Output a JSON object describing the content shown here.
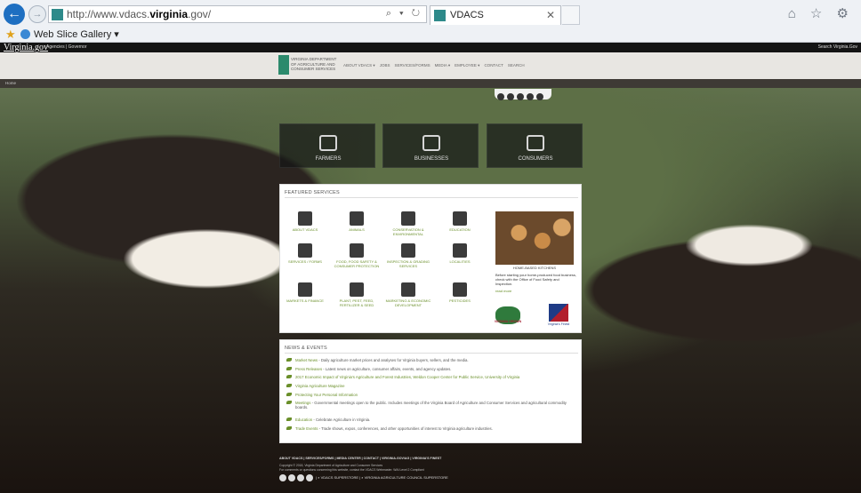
{
  "browser": {
    "url_prefix": "http://www.vdacs.",
    "url_host": "virginia",
    "url_suffix": ".gov/",
    "addr_tools": "⌕ ▾ ↻",
    "tab_title": "VDACS",
    "tab_close": "✕",
    "favorites_label": "Web Slice Gallery ▾",
    "back_glyph": "←",
    "fwd_glyph": "→",
    "chrome_icons": "⌂ ☆ ⚙"
  },
  "site": {
    "va_logo": "Virginia.gov",
    "va_links": "Agencies | Governor",
    "va_search": "Search Virginia.Gov",
    "org_name": "VIRGINIA DEPARTMENT OF AGRICULTURE AND CONSUMER SERVICES",
    "nav": [
      "ABOUT VDACS ▾",
      "JOBS",
      "SERVICES/FORMS",
      "MEDIA ▾",
      "EMPLOYEE ▾",
      "CONTACT",
      "SEARCH"
    ],
    "breadcrumb": "Home"
  },
  "tiles": [
    "FARMERS",
    "BUSINESSES",
    "CONSUMERS"
  ],
  "featured": {
    "heading": "FEATURED SERVICES",
    "services": [
      "ABOUT VDACS",
      "ANIMALS",
      "CONSERVATION & ENVIRONMENTAL",
      "EDUCATION",
      "SERVICES / FORMS",
      "FOOD, FOOD SAFETY & CONSUMER PROTECTION",
      "INSPECTION & GRADING SERVICES",
      "LOCALITIES",
      "MARKETS & FINANCE",
      "PLANT, PEST, FEED, FERTILIZER & SEED",
      "MARKETING & ECONOMIC DEVELOPMENT",
      "PESTICIDES"
    ],
    "promo_caption": "HOME-BASED KITCHENS",
    "promo_text": "Before starting your home-produced food business, check with the Office of Food Safety and Inspection.",
    "promo_more": "read more",
    "logo_grown": "VIRGINIA GROWN",
    "logo_finest": "Virginia's Finest"
  },
  "news": {
    "heading": "NEWS & EVENTS",
    "items": [
      {
        "title": "Market News",
        "text": " - Daily agriculture market prices and analyses for Virginia buyers, sellers, and the media."
      },
      {
        "title": "Press Releases",
        "text": " - Latest news on agriculture, consumer affairs, events, and agency updates."
      },
      {
        "title": "2017 Economic Impact of Virginia's Agriculture and Forest Industries, Weldon Cooper Center for Public Service, University of Virginia",
        "text": ""
      },
      {
        "title": "Virginia Agriculture Magazine",
        "text": ""
      },
      {
        "title": "Protecting Your Personal Information",
        "text": ""
      },
      {
        "title": "Meetings",
        "text": " - Governmental meetings open to the public. Includes meetings of the Virginia Board of Agriculture and Consumer Services and agricultural commodity boards."
      },
      {
        "title": "Education",
        "text": " - Celebrate Agriculture in Virginia."
      },
      {
        "title": "Trade Events",
        "text": " - Trade shows, expos, conferences, and other opportunities of interest to Virginia agriculture industries."
      }
    ]
  },
  "footer": {
    "links": "ABOUT VDACS | SERVICES/FORMS | MEDIA CENTER | CONTACT | VIRGINIA.GOV/AG | VIRGINIA'S FINEST",
    "copy1": "Copyright © 2018, Virginia Department of Agriculture and Consumer Services",
    "copy2": "For comments or questions concerning this website, contact the VDACS Webmaster. WAI Level 2 Compliant",
    "icons_text": "| ⌕ VDACS SUPERSTORE | ⌕ VIRGINIA AGRICULTURE COUNCIL SUPERSTORE"
  }
}
